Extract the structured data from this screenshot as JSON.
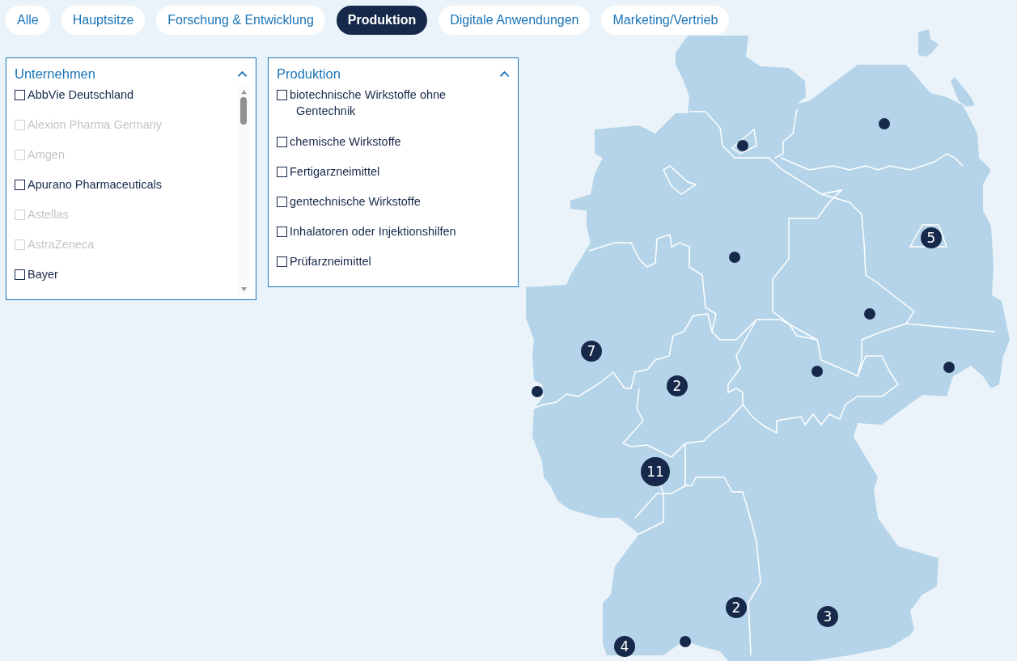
{
  "tabs": [
    {
      "label": "Alle",
      "selected": false
    },
    {
      "label": "Hauptsitze",
      "selected": false
    },
    {
      "label": "Forschung & Entwicklung",
      "selected": false
    },
    {
      "label": "Produktion",
      "selected": true
    },
    {
      "label": "Digitale Anwendungen",
      "selected": false
    },
    {
      "label": "Marketing/Vertrieb",
      "selected": false
    }
  ],
  "filters": [
    {
      "title": "Unternehmen",
      "expanded": true,
      "scrollable": true,
      "items": [
        {
          "label": "AbbVie Deutschland",
          "checked": false,
          "disabled": false
        },
        {
          "label": "Alexion Pharma Germany",
          "checked": false,
          "disabled": true
        },
        {
          "label": "Amgen",
          "checked": false,
          "disabled": true
        },
        {
          "label": "Apurano Pharmaceuticals",
          "checked": false,
          "disabled": false
        },
        {
          "label": "Astellas",
          "checked": false,
          "disabled": true
        },
        {
          "label": "AstraZeneca",
          "checked": false,
          "disabled": true
        },
        {
          "label": "Bayer",
          "checked": false,
          "disabled": false
        }
      ]
    },
    {
      "title": "Produktion",
      "expanded": true,
      "scrollable": false,
      "items": [
        {
          "label": "biotechnische Wirkstoffe ohne Gentechnik",
          "checked": false,
          "disabled": false
        },
        {
          "label": "chemische Wirkstoffe",
          "checked": false,
          "disabled": false
        },
        {
          "label": "Fertigarzneimittel",
          "checked": false,
          "disabled": false
        },
        {
          "label": "gentechnische Wirkstoffe",
          "checked": false,
          "disabled": false
        },
        {
          "label": "Inhalatoren oder Injektionshilfen",
          "checked": false,
          "disabled": false
        },
        {
          "label": "Prüfarzneimittel",
          "checked": false,
          "disabled": false
        }
      ]
    }
  ],
  "map": {
    "markers": [
      {
        "kind": "point"
      },
      {
        "kind": "point"
      },
      {
        "kind": "cluster",
        "count": "5"
      },
      {
        "kind": "point"
      },
      {
        "kind": "point"
      },
      {
        "kind": "cluster",
        "count": "7"
      },
      {
        "kind": "point"
      },
      {
        "kind": "point"
      },
      {
        "kind": "cluster",
        "count": "2"
      },
      {
        "kind": "point"
      },
      {
        "kind": "cluster",
        "count": "11"
      },
      {
        "kind": "cluster",
        "count": "2"
      },
      {
        "kind": "cluster",
        "count": "3"
      },
      {
        "kind": "point"
      },
      {
        "kind": "cluster",
        "count": "4"
      }
    ]
  }
}
